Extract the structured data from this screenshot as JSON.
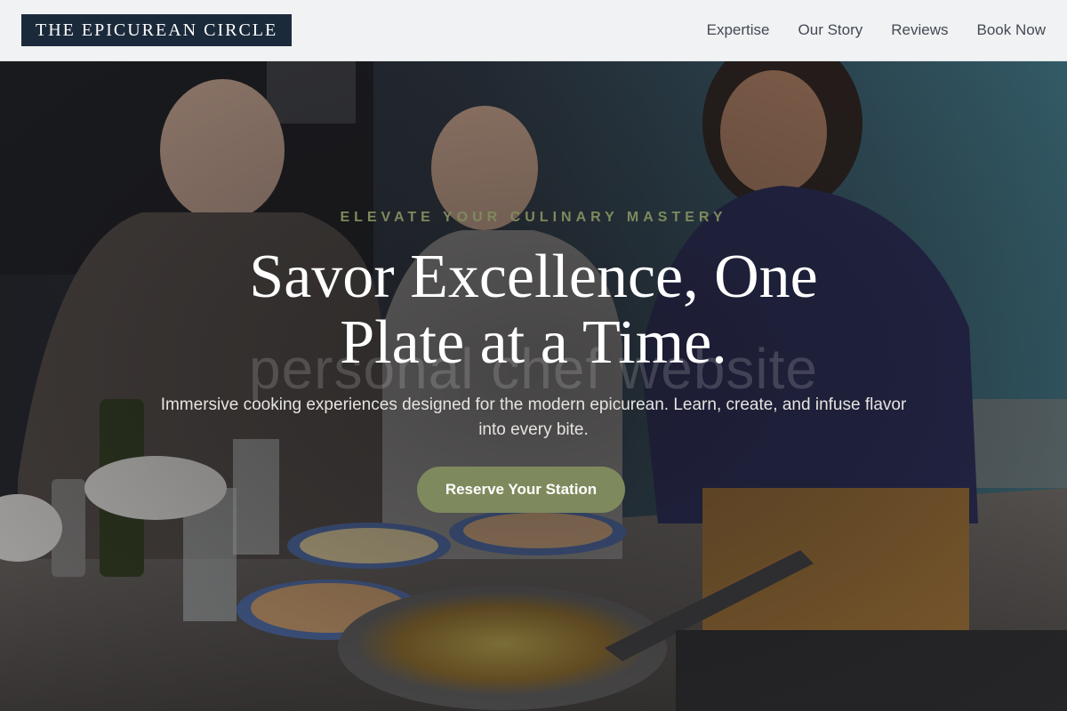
{
  "header": {
    "logo_text": "THE EPICUREAN CIRCLE",
    "nav": [
      {
        "label": "Expertise"
      },
      {
        "label": "Our Story"
      },
      {
        "label": "Reviews"
      },
      {
        "label": "Book Now"
      }
    ]
  },
  "hero": {
    "eyebrow": "ELEVATE YOUR CULINARY MASTERY",
    "headline_line1": "Savor Excellence, One",
    "headline_line2": "Plate at a Time.",
    "watermark": "personal chef website",
    "subtext": "Immersive cooking experiences designed for the modern epicurean. Learn, create, and infuse flavor into every bite.",
    "cta_label": "Reserve Your Station",
    "background": "photo of three people cooking and plating food at a kitchen counter"
  },
  "colors": {
    "logo_bg": "#1b2a3b",
    "header_bg": "#f1f2f3",
    "accent_olive": "#7e8a5d",
    "nav_text": "#434a55",
    "headline_text": "#ffffff"
  }
}
